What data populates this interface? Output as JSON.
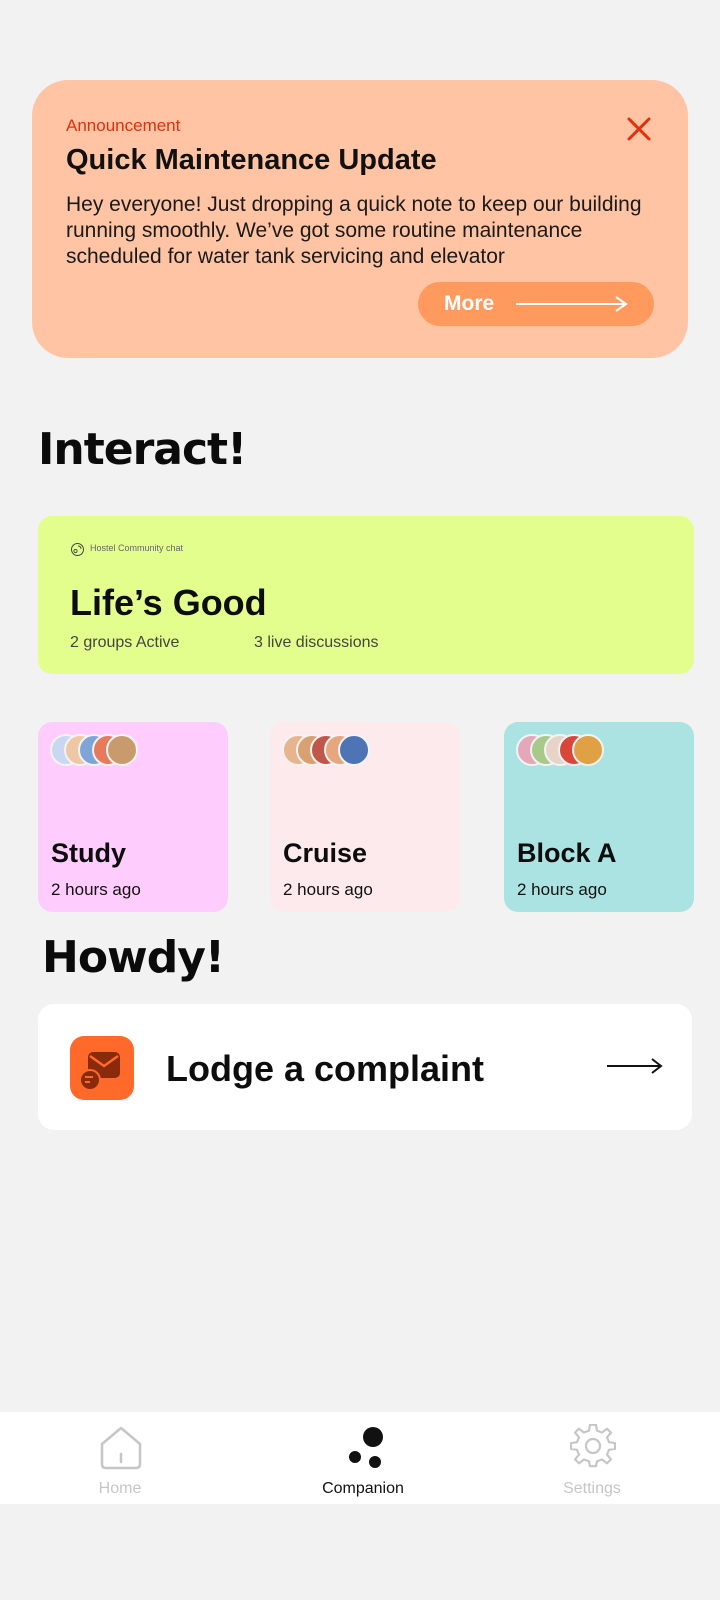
{
  "announcement": {
    "label": "Announcement",
    "title": "Quick Maintenance Update",
    "body": "Hey everyone! Just dropping a quick note to keep our building running smoothly. We’ve got some routine maintenance scheduled for water tank servicing and elevator",
    "more_label": "More",
    "close_icon": "close-icon",
    "accent_color": "#e0300c",
    "background_color": "#ffc4a4"
  },
  "interact": {
    "heading": "Interact!",
    "community": {
      "label": "Hostel Community chat",
      "name": "Life’s Good",
      "groups_active": "2 groups Active",
      "live_discussions": "3 live discussions",
      "background_color": "#e4fe8e"
    },
    "groups": [
      {
        "name": "Study",
        "time": "2 hours ago",
        "background_color": "#ffcdfd"
      },
      {
        "name": "Cruise",
        "time": "2 hours ago",
        "background_color": "#fdeaec"
      },
      {
        "name": "Block A",
        "time": "2 hours ago",
        "background_color": "#aae3e1"
      }
    ]
  },
  "howdy": {
    "heading": "Howdy!",
    "complaint_label": "Lodge a complaint",
    "complaint_icon": "mail-complaint-icon",
    "complaint_icon_color": "#ff6a2a"
  },
  "nav": {
    "items": [
      {
        "label": "Home",
        "icon": "home-icon",
        "active": false
      },
      {
        "label": "Companion",
        "icon": "companion-icon",
        "active": true
      },
      {
        "label": "Settings",
        "icon": "gear-icon",
        "active": false
      }
    ]
  }
}
